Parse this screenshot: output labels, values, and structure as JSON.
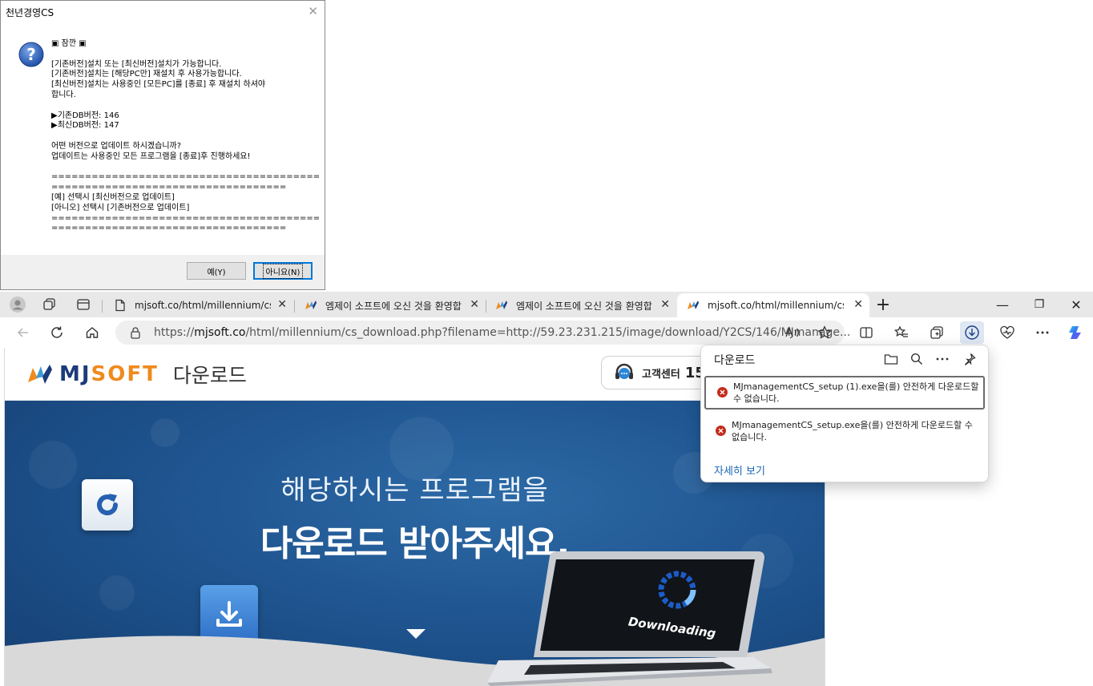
{
  "dialog": {
    "title": "천년경영CS",
    "close_glyph": "✕",
    "message": "▣ 잠깐 ▣\n\n[기존버전]설치 또는 [최신버전]설치가 가능합니다.\n[기존버전]설치는 [해당PC만] 재설치 후 사용가능합니다.\n[최신버전]설치는 사용중인 [모든PC]를 [종료] 후 재설치 하셔야\n합니다.\n\n▶기존DB버전: 146\n▶최신DB버전: 147\n\n어떤 버전으로 업데이트 하시겠습니까?\n업데이트는 사용중인 모든 프로그램을 [종료]후 진행하세요!\n\n========================================\n===================================\n[예] 선택시 [최신버전으로 업데이트]\n[아니오] 선택시 [기존버전으로 업데이트]\n========================================\n===================================",
    "yes_label": "예(Y)",
    "no_label": "아니요(N)"
  },
  "browser": {
    "tabs": [
      {
        "title": "mjsoft.co/html/millennium/cs_do"
      },
      {
        "title": "엠제이 소프트에 오신 것을 환영합"
      },
      {
        "title": "엠제이 소프트에 오신 것을 환영합"
      },
      {
        "title": "mjsoft.co/html/millennium/cs_do"
      }
    ],
    "new_tab_glyph": "+",
    "window": {
      "minimize": "—",
      "maximize": "❐",
      "close": "✕"
    },
    "address": {
      "scheme": "https://",
      "host": "mjsoft.co",
      "path": "/html/millennium/cs_download.php?filename=http://59.23.231.215/image/download/Y2CS/146/MJmanage..."
    }
  },
  "site": {
    "logo_word_left": "MJ",
    "logo_word_right": "SOFT",
    "logo_subtitle": "다운로드",
    "cs_label": "고객센터",
    "cs_number": "15",
    "hero_line1": "해당하시는 프로그램을",
    "hero_line2": "다운로드 받아주세요.",
    "laptop_text": "Downloading"
  },
  "downloads": {
    "title": "다운로드",
    "items": [
      {
        "text": "MJmanagementCS_setup (1).exe을(를) 안전하게 다운로드할 수 없습니다."
      },
      {
        "text": "MJmanagementCS_setup.exe을(를) 안전하게 다운로드할 수 없습니다."
      }
    ],
    "more_link": "자세히 보기"
  },
  "colors": {
    "accent": "#0078d7",
    "error": "#c42b1c",
    "link": "#1a66b5",
    "brand_navy": "#1c3b7a",
    "brand_orange": "#f08a1c",
    "hero_blue": "#1f5590"
  }
}
